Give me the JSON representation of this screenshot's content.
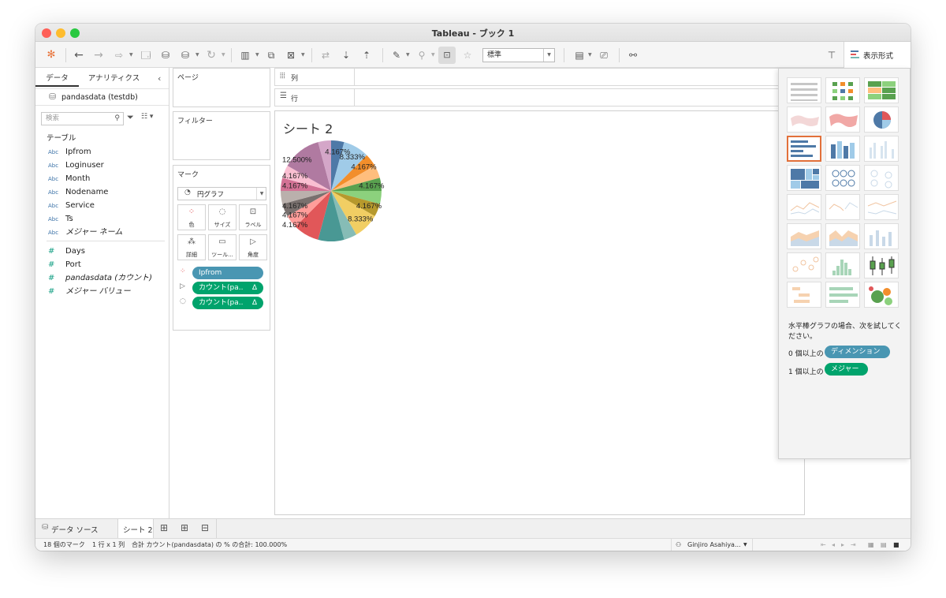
{
  "window": {
    "title": "Tableau - ブック 1"
  },
  "toolbar": {
    "fit_value": "標準",
    "show_me_label": "表示形式"
  },
  "data_pane": {
    "tabs": [
      "データ",
      "アナリティクス"
    ],
    "datasource": "pandasdata (testdb)",
    "search_placeholder": "検索",
    "section": "テーブル",
    "dimensions": [
      {
        "type": "Abc",
        "name": "Ipfrom"
      },
      {
        "type": "Abc",
        "name": "Loginuser"
      },
      {
        "type": "Abc",
        "name": "Month"
      },
      {
        "type": "Abc",
        "name": "Nodename"
      },
      {
        "type": "Abc",
        "name": "Service"
      },
      {
        "type": "Abc",
        "name": "Ts"
      },
      {
        "type": "Abc",
        "name": "メジャー ネーム"
      }
    ],
    "measures": [
      {
        "type": "#",
        "name": "Days"
      },
      {
        "type": "#",
        "name": "Port"
      },
      {
        "type": "#",
        "name": "pandasdata (カウント)"
      },
      {
        "type": "#",
        "name": "メジャー バリュー"
      }
    ]
  },
  "shelves": {
    "pages_title": "ページ",
    "filters_title": "フィルター",
    "marks_title": "マーク",
    "mark_type": "円グラフ",
    "mark_buttons": [
      "色",
      "サイズ",
      "ラベル",
      "詳細",
      "ツール...",
      "角度"
    ],
    "pills": [
      {
        "label": "Ipfrom",
        "color": "#4996b2"
      },
      {
        "label": "カウント(pa..",
        "color": "#00a36c",
        "delta": "Δ"
      },
      {
        "label": "カウント(pa..",
        "color": "#00a36c",
        "delta": "Δ"
      }
    ],
    "columns_label": "列",
    "rows_label": "行"
  },
  "view": {
    "sheet_title": "シート 2"
  },
  "chart_data": {
    "type": "pie",
    "title": "シート 2",
    "slices": [
      {
        "value": 4.167,
        "color": "#4e79a7",
        "label": "4.167%"
      },
      {
        "value": 8.333,
        "color": "#a0cbe8",
        "label": "8.333%"
      },
      {
        "value": 4.167,
        "color": "#f28e2b",
        "label": "4.167%"
      },
      {
        "value": 4.167,
        "color": "#ffbe7d",
        "label": ""
      },
      {
        "value": 4.167,
        "color": "#59a14f",
        "label": "4.167%"
      },
      {
        "value": 4.167,
        "color": "#8cd17d",
        "label": ""
      },
      {
        "value": 4.167,
        "color": "#b6992d",
        "label": "4.167%"
      },
      {
        "value": 8.333,
        "color": "#f1ce63",
        "label": "8.333%"
      },
      {
        "value": 4.167,
        "color": "#86bcb6",
        "label": ""
      },
      {
        "value": 8.333,
        "color": "#499894",
        "label": ""
      },
      {
        "value": 8.333,
        "color": "#e15759",
        "label": "4.167%"
      },
      {
        "value": 4.167,
        "color": "#ff9d9a",
        "label": "4.167%"
      },
      {
        "value": 4.167,
        "color": "#79706e",
        "label": "4.167%"
      },
      {
        "value": 4.167,
        "color": "#bab0ac",
        "label": ""
      },
      {
        "value": 4.167,
        "color": "#d37295",
        "label": "4.167%"
      },
      {
        "value": 4.167,
        "color": "#fabfd2",
        "label": "4.167%"
      },
      {
        "value": 12.5,
        "color": "#b07aa1",
        "label": "12.500%"
      },
      {
        "value": 4.167,
        "color": "#d4a6c8",
        "label": ""
      }
    ]
  },
  "show_me": {
    "hint_text": "水平棒グラフの場合、次を試してください。",
    "dim_prefix": "0 個以上の",
    "dim_pill": "ディメンション",
    "measure_prefix": "1 個以上の",
    "measure_pill": "メジャー"
  },
  "tabs": {
    "datasource_tab": "データ ソース",
    "sheet_tab": "シート 2"
  },
  "status": {
    "marks": "18 個のマーク",
    "rowscols": "1 行 x 1 列",
    "sum": "合計 カウント(pandasdata) の % の合計: 100.000%",
    "user": "Ginjiro Asahiya..."
  }
}
